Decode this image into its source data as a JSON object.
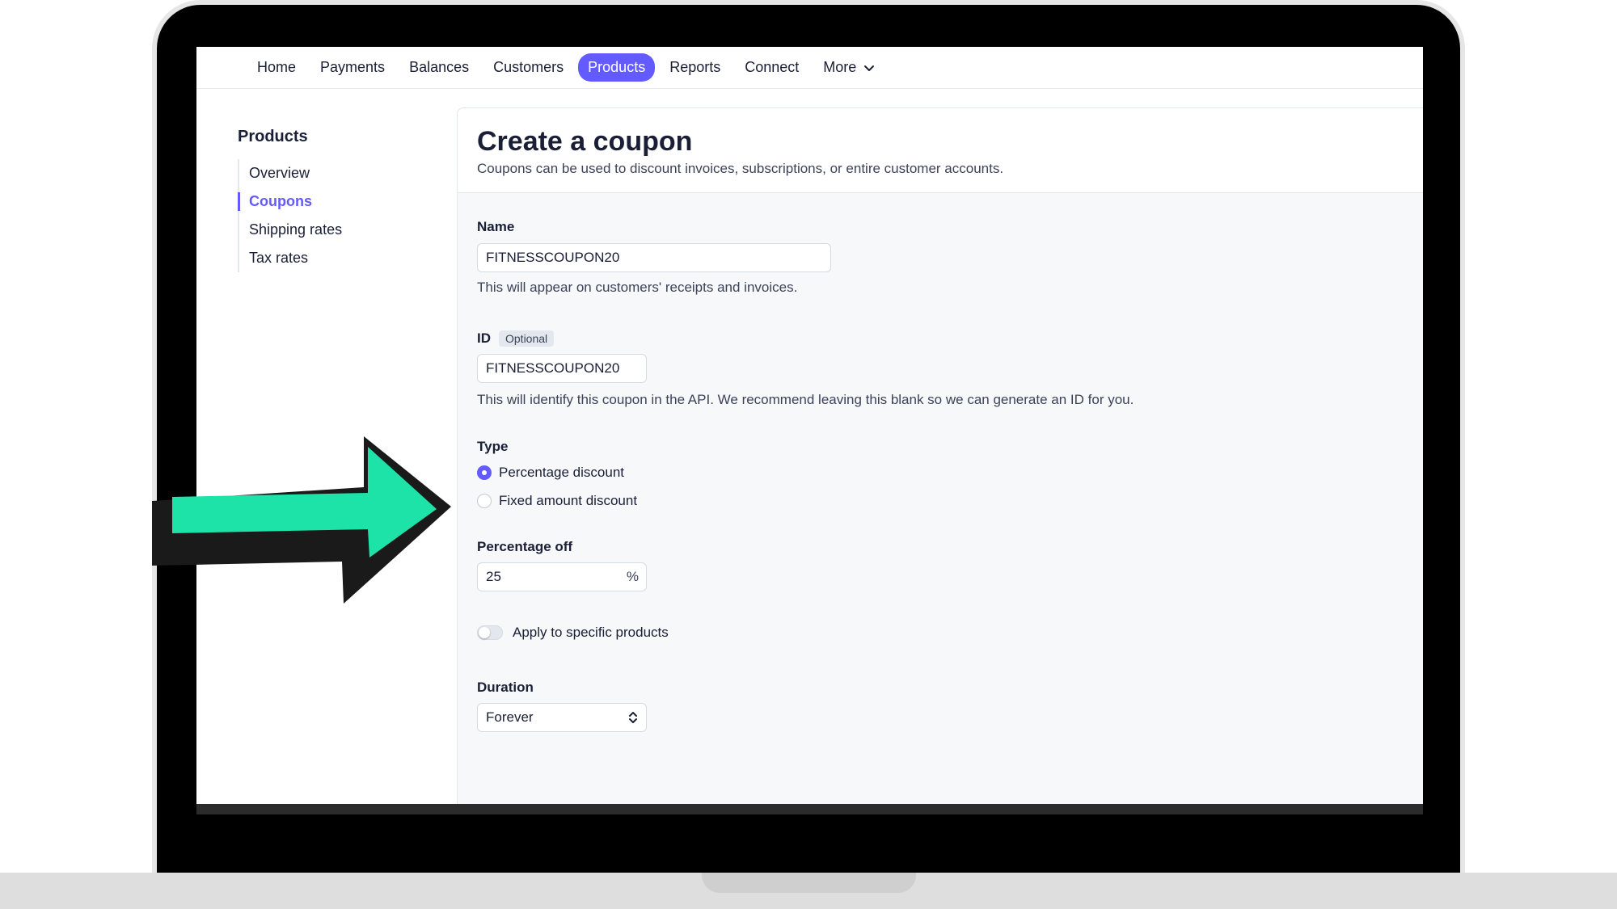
{
  "topnav": {
    "items": [
      "Home",
      "Payments",
      "Balances",
      "Customers",
      "Products",
      "Reports",
      "Connect"
    ],
    "active": "Products",
    "more_label": "More"
  },
  "sidebar": {
    "title": "Products",
    "items": [
      "Overview",
      "Coupons",
      "Shipping rates",
      "Tax rates"
    ],
    "active": "Coupons"
  },
  "header": {
    "title": "Create a coupon",
    "subtitle": "Coupons can be used to discount invoices, subscriptions, or entire customer accounts."
  },
  "form": {
    "name": {
      "label": "Name",
      "value": "FITNESSCOUPON20",
      "help": "This will appear on customers' receipts and invoices."
    },
    "id": {
      "label": "ID",
      "badge": "Optional",
      "value": "FITNESSCOUPON20",
      "help": "This will identify this coupon in the API. We recommend leaving this blank so we can generate an ID for you."
    },
    "type": {
      "label": "Type",
      "options": [
        "Percentage discount",
        "Fixed amount discount"
      ],
      "selected": "Percentage discount"
    },
    "percentage": {
      "label": "Percentage off",
      "value": "25",
      "suffix": "%"
    },
    "apply_products": {
      "label": "Apply to specific products",
      "enabled": false
    },
    "duration": {
      "label": "Duration",
      "value": "Forever"
    }
  },
  "colors": {
    "accent": "#635bff",
    "arrow_fill": "#1ee3a8",
    "arrow_outline": "#1a1a1a"
  }
}
